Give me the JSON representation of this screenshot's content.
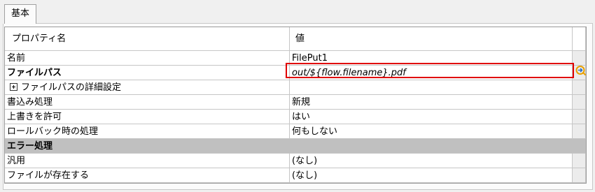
{
  "tabs": [
    {
      "label": "基本",
      "active": true
    }
  ],
  "header": {
    "name_col": "プロパティ名",
    "value_col": "値"
  },
  "rows": [
    {
      "name": "名前",
      "value": "FilePut1"
    },
    {
      "name": "ファイルパス",
      "value": "out/${flow.filename}.pdf",
      "bold": true,
      "italic_value": true,
      "highlighted": true
    },
    {
      "name": "ファイルパスの詳細設定",
      "value": "",
      "expandable": true
    },
    {
      "name": "書込み処理",
      "value": "新規"
    },
    {
      "name": "上書きを許可",
      "value": "はい"
    },
    {
      "name": "ロールバック時の処理",
      "value": "何もしない"
    }
  ],
  "section": {
    "label": "エラー処理"
  },
  "error_rows": [
    {
      "name": "汎用",
      "value": "(なし)"
    },
    {
      "name": "ファイルが存在する",
      "value": "(なし)"
    }
  ],
  "colors": {
    "highlight": "#e00000",
    "section_bg": "#c0c0c0",
    "icon_accent": "#e8a000"
  }
}
